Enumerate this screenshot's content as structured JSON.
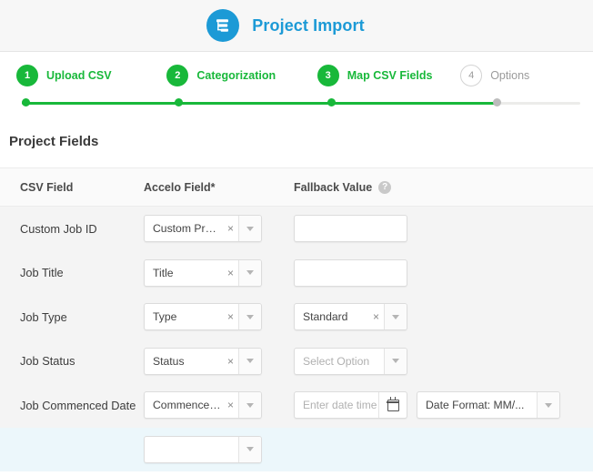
{
  "header": {
    "title": "Project Import",
    "logo_icon": "project-gantt-icon"
  },
  "stepper": {
    "steps": [
      {
        "number": "1",
        "label": "Upload CSV",
        "state": "done"
      },
      {
        "number": "2",
        "label": "Categorization",
        "state": "done"
      },
      {
        "number": "3",
        "label": "Map CSV Fields",
        "state": "done"
      },
      {
        "number": "4",
        "label": "Options",
        "state": "todo"
      }
    ],
    "active_color": "#18b83a",
    "inactive_color": "#9b9b9b"
  },
  "section": {
    "title": "Project Fields"
  },
  "table": {
    "columns": {
      "csv_field": "CSV Field",
      "accelo_field": "Accelo Field*",
      "fallback_value": "Fallback Value",
      "fallback_help_icon": "?"
    },
    "rows": [
      {
        "csv_field": "Custom Job ID",
        "accelo": {
          "value": "Custom Project ID",
          "clearable": true,
          "clear_icon": "×"
        },
        "fallback": {
          "type": "text",
          "value": "",
          "placeholder": ""
        }
      },
      {
        "csv_field": "Job Title",
        "accelo": {
          "value": "Title",
          "clearable": true,
          "clear_icon": "×"
        },
        "fallback": {
          "type": "text",
          "value": "",
          "placeholder": ""
        }
      },
      {
        "csv_field": "Job Type",
        "accelo": {
          "value": "Type",
          "clearable": true,
          "clear_icon": "×"
        },
        "fallback": {
          "type": "select",
          "value": "Standard",
          "clearable": true,
          "clear_icon": "×",
          "is_placeholder": false
        }
      },
      {
        "csv_field": "Job Status",
        "accelo": {
          "value": "Status",
          "clearable": true,
          "clear_icon": "×"
        },
        "fallback": {
          "type": "select",
          "value": "Select Option",
          "clearable": false,
          "is_placeholder": true
        }
      },
      {
        "csv_field": "Job Commenced Date",
        "accelo": {
          "value": "Commenced Date",
          "clearable": true,
          "clear_icon": "×"
        },
        "fallback": {
          "type": "datetime",
          "placeholder": "Enter date time",
          "calendar_icon": "calendar-icon"
        },
        "date_format": {
          "value": "Date Format: MM/..."
        }
      }
    ]
  }
}
